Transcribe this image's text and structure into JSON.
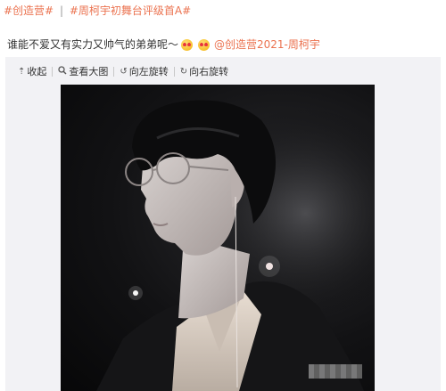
{
  "topics": {
    "first": "#创造营#",
    "separator": "|",
    "second": "#周柯宇初舞台评级首A#"
  },
  "post": {
    "text": "谁能不爱又有实力又帅气的弟弟呢～",
    "emojis": [
      "heart-eyes-emoji",
      "heart-eyes-emoji"
    ],
    "mention": "@创造营2021-周柯宇"
  },
  "media_toolbar": {
    "collapse_label": "收起",
    "view_large_label": "查看大图",
    "rotate_left_label": "向左旋转",
    "rotate_right_label": "向右旋转",
    "icons": {
      "collapse": "collapse-up-icon",
      "view_large": "magnify-icon",
      "rotate_left": "rotate-left-icon",
      "rotate_right": "rotate-right-icon"
    }
  },
  "photo": {
    "description_icon": "portrait-photo",
    "accent_color": "#eb7350"
  }
}
